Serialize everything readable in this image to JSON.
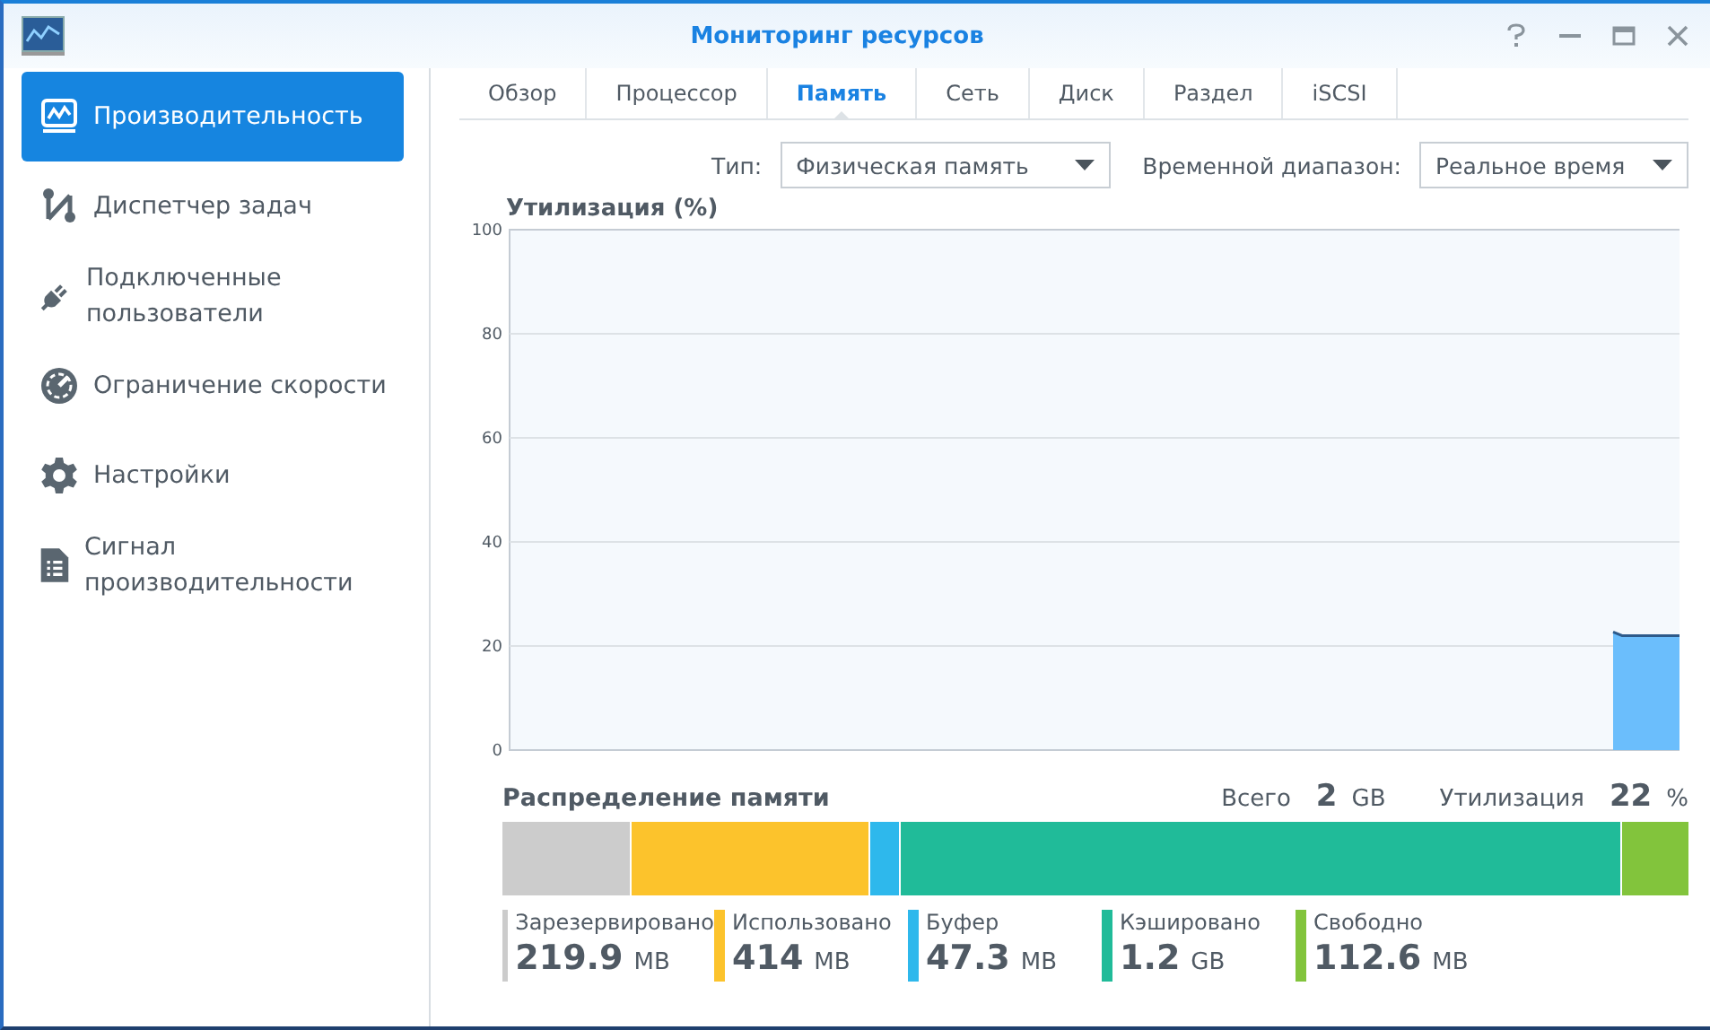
{
  "window": {
    "title": "Мониторинг ресурсов"
  },
  "sidebar": {
    "items": [
      {
        "label": "Производительность",
        "selected": true
      },
      {
        "label": "Диспетчер задач",
        "selected": false
      },
      {
        "label": "Подключенные пользователи",
        "selected": false
      },
      {
        "label": "Ограничение скорости",
        "selected": false
      },
      {
        "label": "Настройки",
        "selected": false
      },
      {
        "label": "Сигнал производительности",
        "selected": false
      }
    ]
  },
  "tabs": [
    {
      "label": "Обзор",
      "selected": false
    },
    {
      "label": "Процессор",
      "selected": false
    },
    {
      "label": "Память",
      "selected": true
    },
    {
      "label": "Сеть",
      "selected": false
    },
    {
      "label": "Диск",
      "selected": false
    },
    {
      "label": "Раздел",
      "selected": false
    },
    {
      "label": "iSCSI",
      "selected": false
    }
  ],
  "filters": [
    {
      "label": "Тип:",
      "value": "Физическая память"
    },
    {
      "label": "Временной диапазон:",
      "value": "Реальное время"
    }
  ],
  "utilization_chart": {
    "title": "Утилизация (%)",
    "y_tick_labels": [
      "100",
      "80",
      "60",
      "40",
      "20",
      "0"
    ]
  },
  "distribution": {
    "title": "Распределение памяти",
    "total_label": "Всего",
    "total_value": "2",
    "total_unit": "GB",
    "util_label": "Утилизация",
    "util_value": "22",
    "util_unit": "%",
    "segments": [
      {
        "label": "Зарезервировано",
        "value": "219.9",
        "unit": "MB",
        "color": "#cccccc"
      },
      {
        "label": "Использовано",
        "value": "414",
        "unit": "MB",
        "color": "#fcc32c"
      },
      {
        "label": "Буфер",
        "value": "47.3",
        "unit": "MB",
        "color": "#2eb8ec"
      },
      {
        "label": "Кэшировано",
        "value": "1.2",
        "unit": "GB",
        "color": "#20bb99"
      },
      {
        "label": "Свободно",
        "value": "112.6",
        "unit": "MB",
        "color": "#82c43c"
      }
    ]
  }
}
